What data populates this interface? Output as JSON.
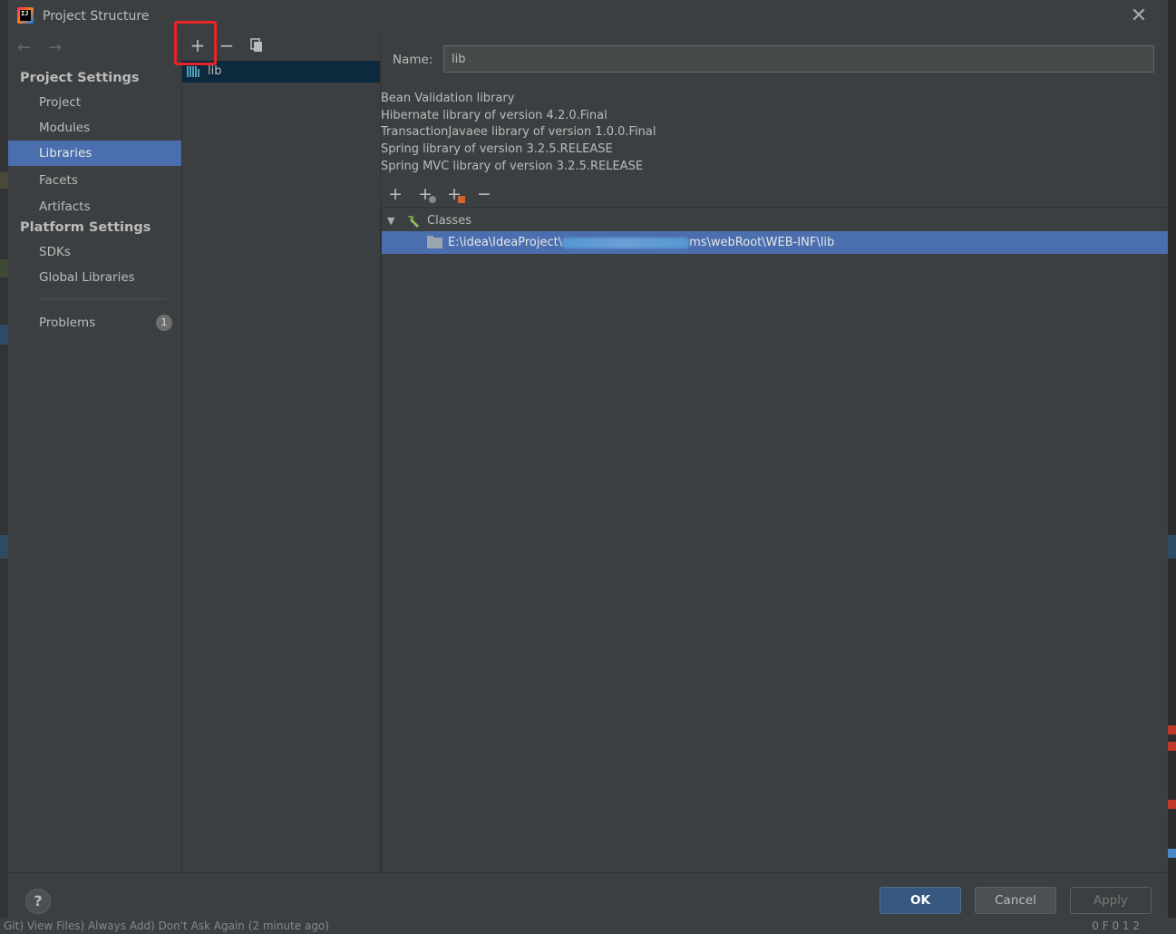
{
  "window": {
    "title": "Project Structure",
    "close_glyph": "✕",
    "app_icon_text": "IJ"
  },
  "nav": {
    "back_glyph": "←",
    "forward_glyph": "→"
  },
  "sidebar": {
    "project_settings_title": "Project Settings",
    "platform_settings_title": "Platform Settings",
    "items": [
      {
        "label": "Project"
      },
      {
        "label": "Modules"
      },
      {
        "label": "Libraries",
        "selected": true
      },
      {
        "label": "Facets"
      },
      {
        "label": "Artifacts"
      }
    ],
    "platform_items": [
      {
        "label": "SDKs"
      },
      {
        "label": "Global Libraries"
      }
    ],
    "problems": {
      "label": "Problems",
      "count": "1"
    }
  },
  "libraries_panel": {
    "toolbar": {
      "add_glyph": "+",
      "remove_glyph": "−",
      "copy_icon": "copy-icon"
    },
    "items": [
      {
        "label": "lib",
        "icon": "library-icon",
        "selected": true
      }
    ]
  },
  "details": {
    "name_label": "Name:",
    "name_value": "lib",
    "descriptions": [
      "Bean Validation library",
      "Hibernate library of version 4.2.0.Final",
      "TransactionJavaee library of version 1.0.0.Final",
      "Spring library of version 3.2.5.RELEASE",
      "Spring MVC library of version 3.2.5.RELEASE"
    ],
    "tree_toolbar": {
      "add_glyph": "+",
      "add_special_icon": "add-plus-icon",
      "add_jar_icon": "add-jar-icon",
      "remove_glyph": "−"
    },
    "tree": {
      "root_label": "Classes",
      "root_icon": "hammer-icon",
      "expander_glyph": "▼",
      "entry_prefix": "E:\\idea\\IdeaProject\\",
      "entry_suffix": "ms\\webRoot\\WEB-INF\\lib",
      "entry_icon": "folder-icon"
    }
  },
  "footer": {
    "help_glyph": "?",
    "ok_label": "OK",
    "cancel_label": "Cancel",
    "apply_label": "Apply"
  },
  "background": {
    "status_text": "Git) View Files) Always Add) Don't Ask Again (2 minute ago)",
    "status_right": "0 F 0 1 2"
  },
  "colors": {
    "selection": "#4b6eaf",
    "list_selection": "#0d293e",
    "highlight_box": "#e8232a",
    "ok_button": "#365880"
  }
}
